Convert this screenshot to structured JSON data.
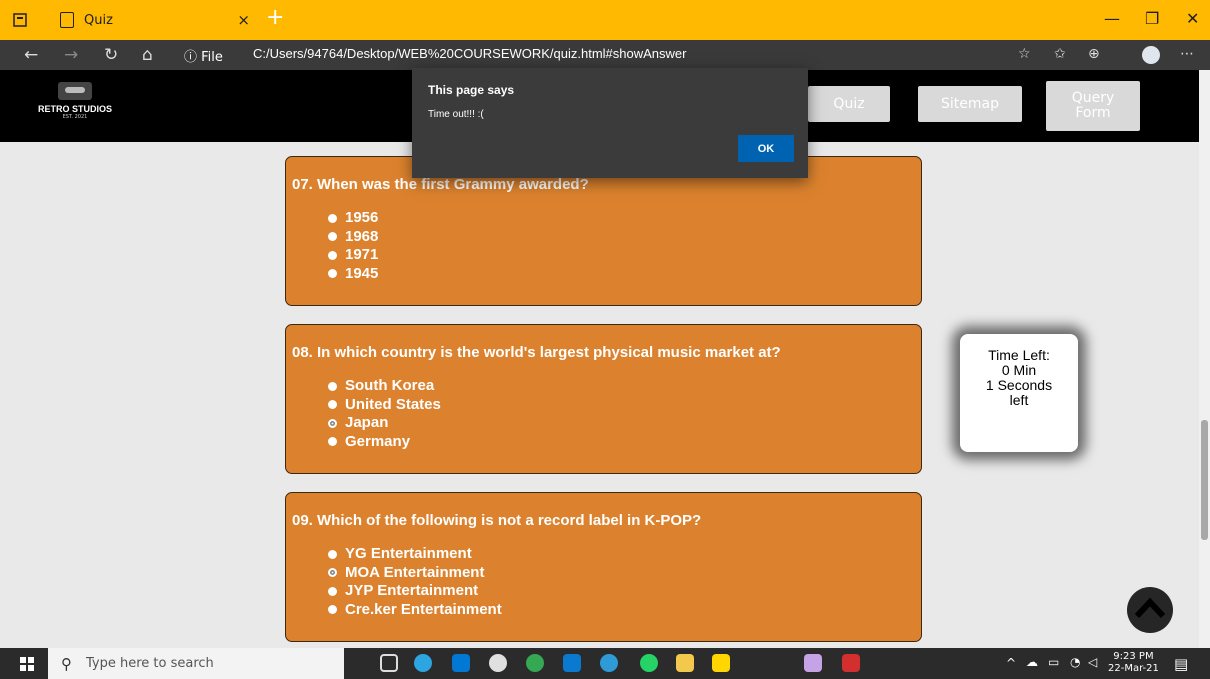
{
  "browser": {
    "tab_title": "Quiz",
    "tab_close": "×",
    "new_tab": "+",
    "address_info": "ⓘ File",
    "url": "C:/Users/94764/Desktop/WEB%20COURSEWORK/quiz.html#showAnswer"
  },
  "site": {
    "brand": "RETRO STUDIOS",
    "est": "EST. 2021",
    "nav": [
      "Quiz",
      "Sitemap",
      "Query Form"
    ]
  },
  "questions": [
    {
      "text": "07. When was the first Grammy awarded?",
      "options": [
        "1956",
        "1968",
        "1971",
        "1945"
      ],
      "selected": -1
    },
    {
      "text": "08. In which country is the world's largest physical music market at?",
      "options": [
        "South Korea",
        "United States",
        "Japan",
        "Germany"
      ],
      "selected": 2
    },
    {
      "text": "09. Which of the following is not a record label in K-POP?",
      "options": [
        "YG Entertainment",
        "MOA Entertainment",
        "JYP Entertainment",
        "Cre.ker Entertainment"
      ],
      "selected": 1
    }
  ],
  "timer": {
    "label": "Time Left:",
    "minutes": "0 Min",
    "seconds": "1 Seconds",
    "suffix": "left"
  },
  "dialog": {
    "title": "This page says",
    "message": "Time out!!! :(",
    "ok": "OK"
  },
  "taskbar": {
    "search_placeholder": "Type here to search",
    "time": "9:23 PM",
    "date": "22-Mar-21"
  }
}
